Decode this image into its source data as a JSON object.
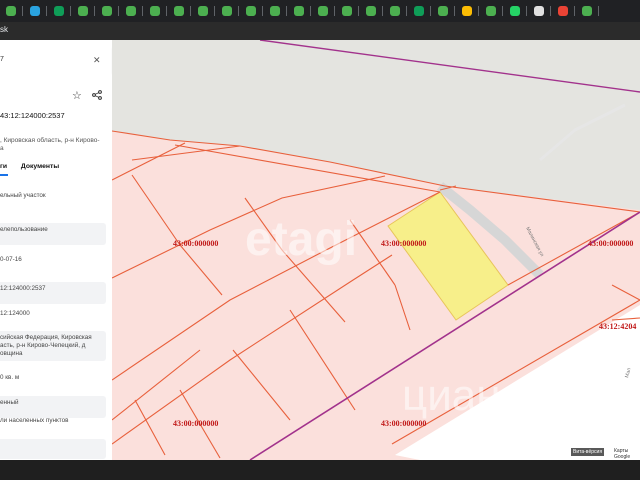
{
  "browser": {
    "tab_icons": [
      {
        "name": "grid-icon",
        "color": "#4caf50"
      },
      {
        "name": "telegram-icon",
        "color": "#2aa3e0"
      },
      {
        "name": "sheets-icon",
        "color": "#0f9d58"
      },
      {
        "name": "grid-icon",
        "color": "#4caf50"
      },
      {
        "name": "grid-icon",
        "color": "#4caf50"
      },
      {
        "name": "grid-icon",
        "color": "#4caf50"
      },
      {
        "name": "grid-icon",
        "color": "#4caf50"
      },
      {
        "name": "grid-icon",
        "color": "#4caf50"
      },
      {
        "name": "grid-icon",
        "color": "#4caf50"
      },
      {
        "name": "grid-icon",
        "color": "#4caf50"
      },
      {
        "name": "grid-icon",
        "color": "#4caf50"
      },
      {
        "name": "grid-icon",
        "color": "#4caf50"
      },
      {
        "name": "grid-icon",
        "color": "#4caf50"
      },
      {
        "name": "grid-icon",
        "color": "#4caf50"
      },
      {
        "name": "grid-icon",
        "color": "#4caf50"
      },
      {
        "name": "grid-icon",
        "color": "#4caf50"
      },
      {
        "name": "grid-icon",
        "color": "#4caf50"
      },
      {
        "name": "sheets-icon",
        "color": "#0f9d58"
      },
      {
        "name": "grid-icon",
        "color": "#4caf50"
      },
      {
        "name": "bookmark-icon",
        "color": "#fbbc04"
      },
      {
        "name": "grid-icon",
        "color": "#4caf50"
      },
      {
        "name": "whatsapp-icon",
        "color": "#25d366"
      },
      {
        "name": "mail-icon",
        "color": "#e0e0e0"
      },
      {
        "name": "maps-pin-icon",
        "color": "#ea4335"
      },
      {
        "name": "grid-icon",
        "color": "#4caf50"
      }
    ],
    "url_text": "sk"
  },
  "panel": {
    "search_value": "7",
    "cadastral_title": "43:12:124000:2537",
    "address": ", Кировская область, р-н Кирово-\nа",
    "tabs": [
      "ги",
      "Документы"
    ],
    "rows": [
      {
        "text": "ельный участок",
        "bg": false
      },
      {
        "text": "елепользование",
        "bg": true
      },
      {
        "text": "0-07-16",
        "bg": false
      },
      {
        "text": "12:124000:2537",
        "bg": true
      },
      {
        "text": "12:124000",
        "bg": false
      },
      {
        "text": "сийская Федерация, Кировская\nасть, р-н Кирово-Чепецкий, д\nовщина",
        "bg": true
      },
      {
        "text": "0 кв. м",
        "bg": false
      },
      {
        "text": "енный",
        "bg": true
      },
      {
        "text": "ли населенных пунктов",
        "bg": false
      },
      {
        "text": "",
        "bg": true
      }
    ]
  },
  "map": {
    "labels": [
      {
        "id": "parcel-label-1",
        "text": "43:00:000000"
      },
      {
        "id": "parcel-label-2",
        "text": "43:00:000000"
      },
      {
        "id": "parcel-label-3",
        "text": "43:00:000000"
      },
      {
        "id": "parcel-label-4",
        "text": "43:12:4204"
      },
      {
        "id": "parcel-label-5",
        "text": "43:00:000000"
      },
      {
        "id": "parcel-label-6",
        "text": "43:00:000000"
      }
    ],
    "road_label_1": "Малинская ул",
    "road_label_2": "Мал",
    "watermark_1": "etagi",
    "watermark_2": "циан",
    "attribution_1": "Вита-вёрсия",
    "attribution_2": "Карты Google",
    "colors": {
      "land_pink": "#fbe0dc",
      "parcel_border": "#e8603c",
      "boundary": "#a2328c",
      "selected": "#f7ef8a",
      "unclassified": "#e4e4e0",
      "label": "#c01818"
    }
  }
}
